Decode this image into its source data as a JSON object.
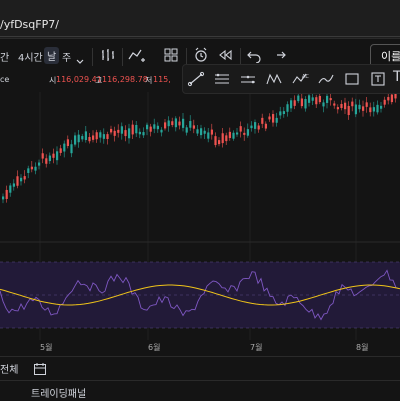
{
  "url": "/yfDsqFP7/",
  "toolbar": {
    "interval_partial": "간",
    "interval_4h": "4시간",
    "interval_day": "날",
    "interval_week": "주",
    "login_partial": "이를"
  },
  "ohlc": {
    "symbol_partial": "ce",
    "open_label": "시",
    "open_value": "116,029.41",
    "high_label": "고",
    "high_value": "116,298.78",
    "low_label": "저",
    "low_value": "115,"
  },
  "drawing_tools": [
    "line-tool-icon",
    "horizontal-lines-icon",
    "channel-icon",
    "pattern-icon",
    "projection-icon",
    "brush-icon",
    "text-icon"
  ],
  "x_axis_months": [
    "5월",
    "6월",
    "7월",
    "8월"
  ],
  "bottom": {
    "all_label": "전체",
    "trading_panel": "트레이딩패널"
  },
  "colors": {
    "up": "#26a69a",
    "down": "#ef5350",
    "rsi_line": "#7e57c2",
    "rsi_ma": "#f0c419",
    "rsi_band": "#2a1f47"
  }
}
